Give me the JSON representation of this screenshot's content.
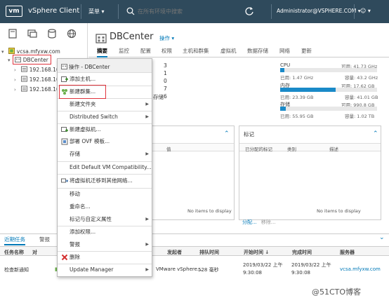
{
  "header": {
    "logo": "vm",
    "title": "vSphere Client",
    "menu_label": "菜单 ▾",
    "search_placeholder": "在所有环境中搜索",
    "user": "Administrator@VSPHERE.COM ▾",
    "help": "☺ ▾"
  },
  "tree": {
    "root": "vcsa.mfyxw.com",
    "datacenter": "DBCenter",
    "hosts": [
      "192.168.10.10",
      "192.168.10.20",
      "192.168.10.30"
    ]
  },
  "main": {
    "title": "DBCenter",
    "actions": "操作 ▾",
    "tabs": [
      "摘要",
      "监控",
      "配置",
      "权限",
      "主机和群集",
      "虚拟机",
      "数据存储",
      "网络",
      "更新"
    ],
    "counts": [
      "3",
      "1",
      "0",
      "7",
      "1",
      "6"
    ],
    "count_suffix": "存储",
    "resources": {
      "cpu": {
        "label": "CPU",
        "free": "可用: 41.73 GHz",
        "used": "已用: 1.47 GHz",
        "capacity": "容量: 43.2 GHz",
        "fill": 0.04
      },
      "memory": {
        "label": "内存",
        "free": "可用: 17.62 GB",
        "used": "已用: 23.39 GB",
        "capacity": "容量: 41.01 GB",
        "fill": 0.57
      },
      "storage": {
        "label": "存储",
        "free": "可用: 990.8 GB",
        "used": "已用: 55.95 GB",
        "capacity": "容量: 1.02 TB",
        "fill": 0.055
      }
    },
    "card_left": {
      "col_value": "值",
      "no_items": "No items to display"
    },
    "card_right": {
      "title": "标记",
      "cols": [
        "已分配的标记",
        "类别",
        "描述"
      ],
      "no_items": "No items to display",
      "assign": "分配...",
      "remove": "移除..."
    }
  },
  "context_menu": {
    "header": "操作 - DBCenter",
    "items": [
      {
        "label": "添加主机...",
        "submenu": false
      },
      {
        "label": "新建群集...",
        "submenu": false
      },
      {
        "label": "新建文件夹",
        "submenu": true
      },
      {
        "label": "Distributed Switch",
        "submenu": true
      },
      {
        "label": "新建虚拟机...",
        "submenu": false
      },
      {
        "label": "部署 OVF 模板...",
        "submenu": false
      },
      {
        "label": "存储",
        "submenu": true
      },
      {
        "label": "Edit Default VM Compatibility...",
        "submenu": false
      },
      {
        "label": "将虚拟机迁移到其他网络...",
        "submenu": false
      },
      {
        "label": "移动",
        "submenu": false
      },
      {
        "label": "重命名...",
        "submenu": false
      },
      {
        "label": "标记与自定义属性",
        "submenu": true
      },
      {
        "label": "添加权限...",
        "submenu": false
      },
      {
        "label": "警报",
        "submenu": true
      },
      {
        "label": "删除",
        "submenu": false
      },
      {
        "label": "Update Manager",
        "submenu": true
      }
    ]
  },
  "recent_tasks": {
    "tabs": [
      "近期任务",
      "警报"
    ],
    "columns": [
      "任务名称",
      "对",
      "发起者",
      "排队时间",
      "开始时间 ↓",
      "完成时间",
      "服务器"
    ],
    "row": {
      "name": "检查新通知",
      "initiator": "VMware vSphere...",
      "queued": "528 毫秒",
      "start": "2019/03/22 上午 9:30:08",
      "complete": "2019/03/22 上午 9:30:08",
      "server": "vcsa.mfyxw.com"
    }
  },
  "watermark": "@51CTO博客",
  "colors": {
    "header_bg": "#2f4a5c",
    "accent": "#0079b8",
    "highlight": "#e0333c",
    "bar": "#1a8ac8"
  }
}
